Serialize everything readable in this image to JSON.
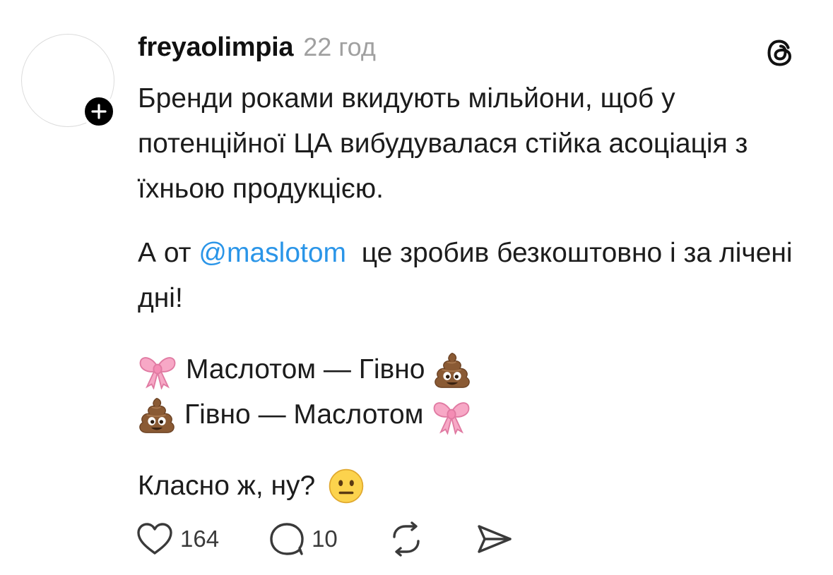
{
  "post": {
    "username": "freyaolimpia",
    "time": "22 год",
    "paragraph1": "Бренди роками вкидують мільйони, щоб у потенційної ЦА вибудувалася стійка асоціація з їхньою продукцією.",
    "paragraph2": {
      "prefix": "А от",
      "mention": "@maslotom",
      "suffix": "це зробив безкоштовно і за лічені дні!"
    },
    "line1": "Маслотом — Гівно",
    "line2": "Гівно — Маслотом",
    "closing": "Класно ж, ну?",
    "icons": {
      "bow": "ribbon-bow-icon",
      "poop": "pile-of-poo-icon",
      "neutral": "neutral-face-icon",
      "logo": "threads-logo-icon"
    },
    "mention_color": "#2a95e8"
  },
  "actions": {
    "likes": "164",
    "replies": "10"
  }
}
